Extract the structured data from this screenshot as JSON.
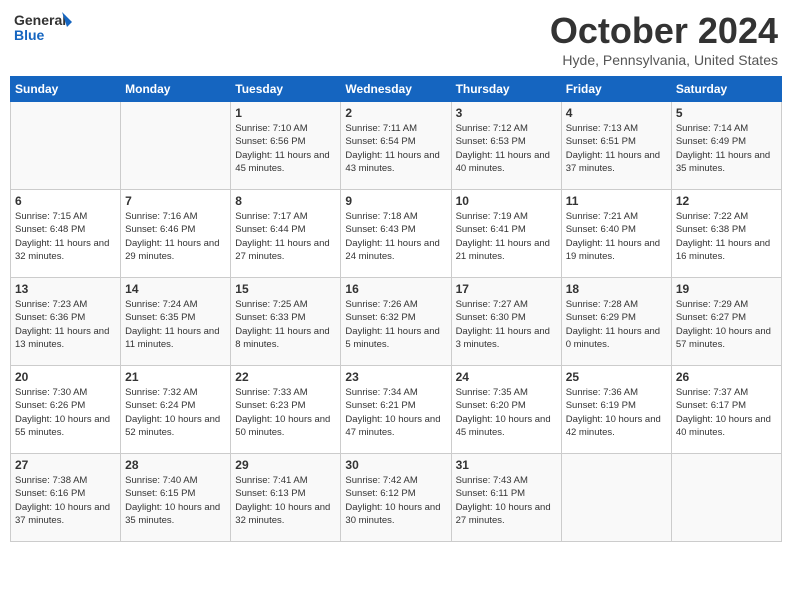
{
  "header": {
    "logo_line1": "General",
    "logo_line2": "Blue",
    "month_title": "October 2024",
    "location": "Hyde, Pennsylvania, United States"
  },
  "days_of_week": [
    "Sunday",
    "Monday",
    "Tuesday",
    "Wednesday",
    "Thursday",
    "Friday",
    "Saturday"
  ],
  "weeks": [
    [
      {
        "day": "",
        "info": ""
      },
      {
        "day": "",
        "info": ""
      },
      {
        "day": "1",
        "info": "Sunrise: 7:10 AM\nSunset: 6:56 PM\nDaylight: 11 hours and 45 minutes."
      },
      {
        "day": "2",
        "info": "Sunrise: 7:11 AM\nSunset: 6:54 PM\nDaylight: 11 hours and 43 minutes."
      },
      {
        "day": "3",
        "info": "Sunrise: 7:12 AM\nSunset: 6:53 PM\nDaylight: 11 hours and 40 minutes."
      },
      {
        "day": "4",
        "info": "Sunrise: 7:13 AM\nSunset: 6:51 PM\nDaylight: 11 hours and 37 minutes."
      },
      {
        "day": "5",
        "info": "Sunrise: 7:14 AM\nSunset: 6:49 PM\nDaylight: 11 hours and 35 minutes."
      }
    ],
    [
      {
        "day": "6",
        "info": "Sunrise: 7:15 AM\nSunset: 6:48 PM\nDaylight: 11 hours and 32 minutes."
      },
      {
        "day": "7",
        "info": "Sunrise: 7:16 AM\nSunset: 6:46 PM\nDaylight: 11 hours and 29 minutes."
      },
      {
        "day": "8",
        "info": "Sunrise: 7:17 AM\nSunset: 6:44 PM\nDaylight: 11 hours and 27 minutes."
      },
      {
        "day": "9",
        "info": "Sunrise: 7:18 AM\nSunset: 6:43 PM\nDaylight: 11 hours and 24 minutes."
      },
      {
        "day": "10",
        "info": "Sunrise: 7:19 AM\nSunset: 6:41 PM\nDaylight: 11 hours and 21 minutes."
      },
      {
        "day": "11",
        "info": "Sunrise: 7:21 AM\nSunset: 6:40 PM\nDaylight: 11 hours and 19 minutes."
      },
      {
        "day": "12",
        "info": "Sunrise: 7:22 AM\nSunset: 6:38 PM\nDaylight: 11 hours and 16 minutes."
      }
    ],
    [
      {
        "day": "13",
        "info": "Sunrise: 7:23 AM\nSunset: 6:36 PM\nDaylight: 11 hours and 13 minutes."
      },
      {
        "day": "14",
        "info": "Sunrise: 7:24 AM\nSunset: 6:35 PM\nDaylight: 11 hours and 11 minutes."
      },
      {
        "day": "15",
        "info": "Sunrise: 7:25 AM\nSunset: 6:33 PM\nDaylight: 11 hours and 8 minutes."
      },
      {
        "day": "16",
        "info": "Sunrise: 7:26 AM\nSunset: 6:32 PM\nDaylight: 11 hours and 5 minutes."
      },
      {
        "day": "17",
        "info": "Sunrise: 7:27 AM\nSunset: 6:30 PM\nDaylight: 11 hours and 3 minutes."
      },
      {
        "day": "18",
        "info": "Sunrise: 7:28 AM\nSunset: 6:29 PM\nDaylight: 11 hours and 0 minutes."
      },
      {
        "day": "19",
        "info": "Sunrise: 7:29 AM\nSunset: 6:27 PM\nDaylight: 10 hours and 57 minutes."
      }
    ],
    [
      {
        "day": "20",
        "info": "Sunrise: 7:30 AM\nSunset: 6:26 PM\nDaylight: 10 hours and 55 minutes."
      },
      {
        "day": "21",
        "info": "Sunrise: 7:32 AM\nSunset: 6:24 PM\nDaylight: 10 hours and 52 minutes."
      },
      {
        "day": "22",
        "info": "Sunrise: 7:33 AM\nSunset: 6:23 PM\nDaylight: 10 hours and 50 minutes."
      },
      {
        "day": "23",
        "info": "Sunrise: 7:34 AM\nSunset: 6:21 PM\nDaylight: 10 hours and 47 minutes."
      },
      {
        "day": "24",
        "info": "Sunrise: 7:35 AM\nSunset: 6:20 PM\nDaylight: 10 hours and 45 minutes."
      },
      {
        "day": "25",
        "info": "Sunrise: 7:36 AM\nSunset: 6:19 PM\nDaylight: 10 hours and 42 minutes."
      },
      {
        "day": "26",
        "info": "Sunrise: 7:37 AM\nSunset: 6:17 PM\nDaylight: 10 hours and 40 minutes."
      }
    ],
    [
      {
        "day": "27",
        "info": "Sunrise: 7:38 AM\nSunset: 6:16 PM\nDaylight: 10 hours and 37 minutes."
      },
      {
        "day": "28",
        "info": "Sunrise: 7:40 AM\nSunset: 6:15 PM\nDaylight: 10 hours and 35 minutes."
      },
      {
        "day": "29",
        "info": "Sunrise: 7:41 AM\nSunset: 6:13 PM\nDaylight: 10 hours and 32 minutes."
      },
      {
        "day": "30",
        "info": "Sunrise: 7:42 AM\nSunset: 6:12 PM\nDaylight: 10 hours and 30 minutes."
      },
      {
        "day": "31",
        "info": "Sunrise: 7:43 AM\nSunset: 6:11 PM\nDaylight: 10 hours and 27 minutes."
      },
      {
        "day": "",
        "info": ""
      },
      {
        "day": "",
        "info": ""
      }
    ]
  ]
}
